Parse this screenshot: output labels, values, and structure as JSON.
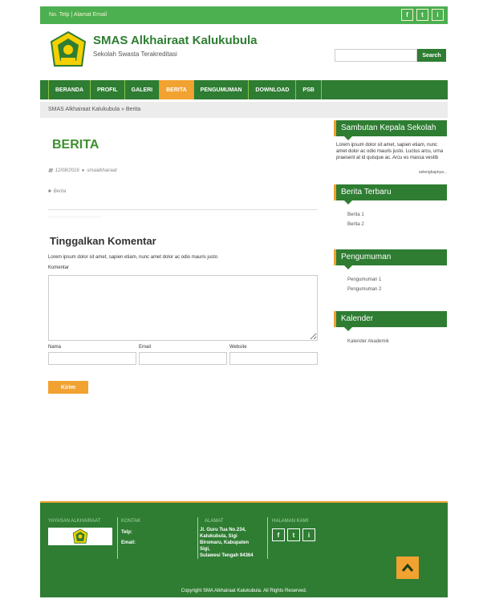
{
  "topbar": {
    "contact_text": "No. Telp | Alamat Email",
    "social": [
      "f",
      "t",
      "i"
    ]
  },
  "header": {
    "title": "SMAS Alkhairaat Kalukubula",
    "subtitle": "Sekolah Swasta Terakreditasi",
    "search_placeholder": "",
    "search_button": "Search"
  },
  "nav": {
    "items": [
      "BERANDA",
      "PROFIL",
      "GALERI",
      "BERITA",
      "PENGUMUMAN",
      "DOWNLOAD",
      "PSB"
    ],
    "active_index": 3
  },
  "breadcrumb": "SMAS Alkhairaat Kalukubula » Berita",
  "main": {
    "page_title": "BERITA",
    "date": "12/08/2016",
    "author": "smaalkhairaat",
    "category": "Berita",
    "comment_title": "Tinggalkan Komentar",
    "comment_desc": "Lorem ipsum dolor sit amet, sapien etiam, nunc amet dolor ac odio mauris justo",
    "comment_label": "Komentar",
    "fields": [
      "Nama",
      "Email",
      "Website"
    ],
    "submit": "Kirim"
  },
  "sidebar": {
    "sambutan": {
      "title": "Sambutan Kepala Sekolah",
      "text": "Lorem ipsum dolor sit amet, sapien etiam, nunc amet dolor ac odio mauris justo. Luctus arcu, urna praesent at id quisque ac. Arcu es massa vestib",
      "read_more": "selengkapnya..."
    },
    "berita": {
      "title": "Berita Terbaru",
      "items": [
        "Berita 1",
        "Berita 2"
      ]
    },
    "pengumuman": {
      "title": "Pengumuman",
      "items": [
        "Pengumuman 1",
        "Pengumuman 2"
      ]
    },
    "kalender": {
      "title": "Kalender",
      "items": [
        "Kalender Akademik"
      ]
    }
  },
  "footer": {
    "col1_title": "YAYASAN ALKHAIRAAT",
    "col2_title": "KONTAK",
    "kontak_telp": "Telp:",
    "kontak_email": "Email:",
    "col3_title": "ALAMAT",
    "alamat": "Jl. Guru Tua No.234,\nKalukubula, Sigi\nBiromaru, Kabupaten\nSigi,\nSulawesi Tengah 94364",
    "col4_title": "HALAMAN KAMI",
    "social": [
      "f",
      "t",
      "i"
    ],
    "copyright": "Copyright SMA Alkhairaat Kalukubula. All Rights Reserved."
  },
  "colors": {
    "primary_green": "#2e7d32",
    "topbar_green": "#4caf50",
    "accent_orange": "#f2a231"
  }
}
